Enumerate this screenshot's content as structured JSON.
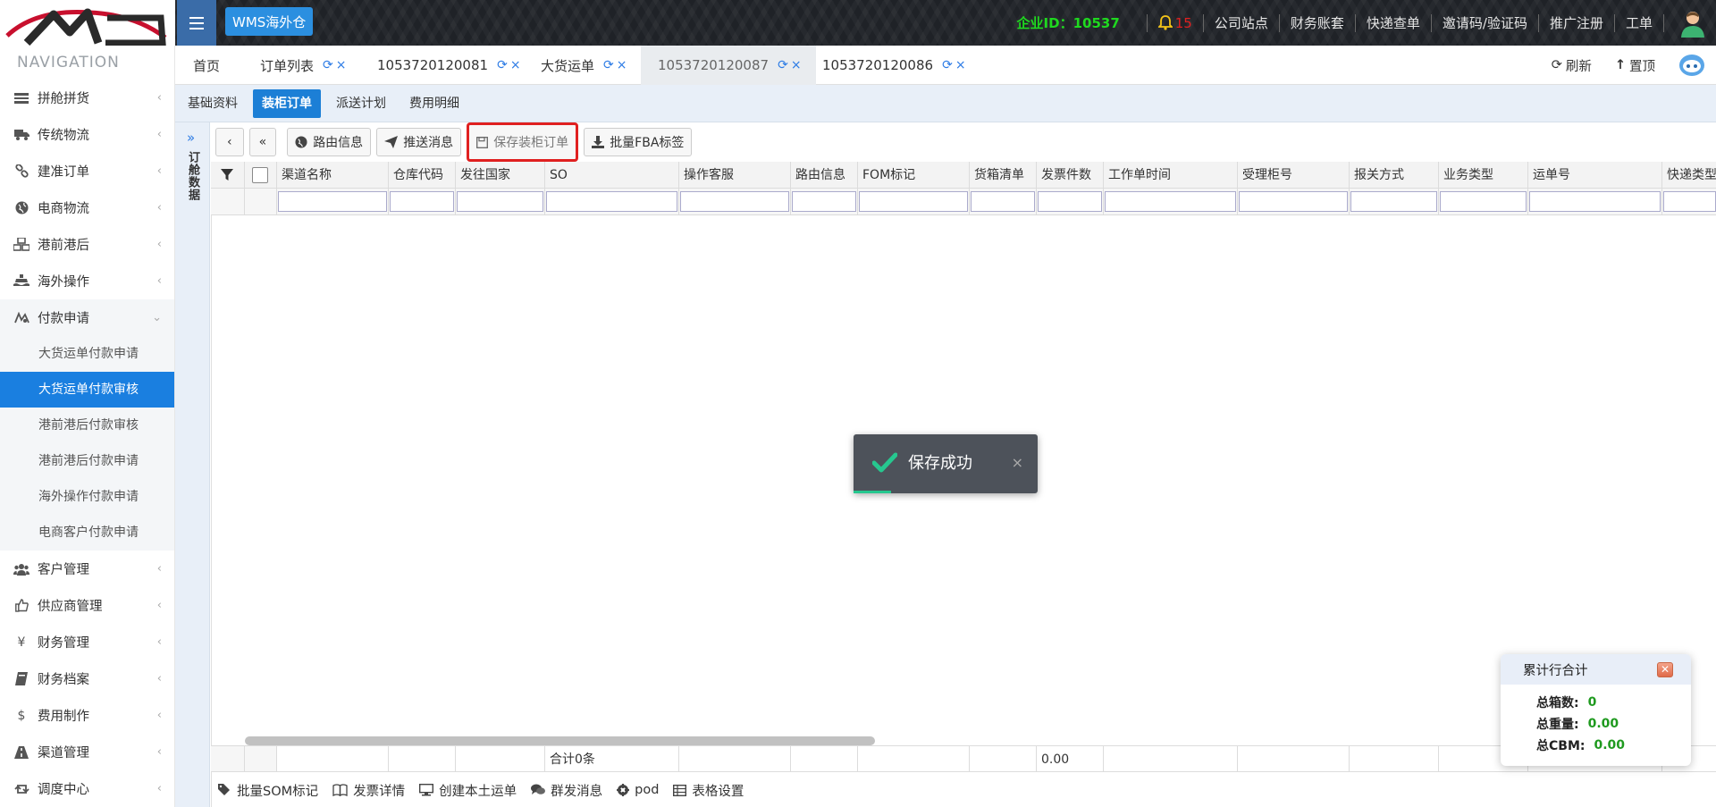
{
  "header": {
    "badge": "WMS海外仓",
    "company_id": "企业ID：10537",
    "notification_count": "15",
    "links": [
      "公司站点",
      "财务账套",
      "快递查单",
      "邀请码/验证码",
      "推广注册",
      "工单"
    ],
    "accent_color": "#1fd91f"
  },
  "sidebar": {
    "title": "NAVIGATION",
    "items": [
      {
        "label": "拼舱拼货",
        "icon": "list-icon"
      },
      {
        "label": "传统物流",
        "icon": "truck-icon"
      },
      {
        "label": "建准订单",
        "icon": "link-icon"
      },
      {
        "label": "电商物流",
        "icon": "globe-icon"
      },
      {
        "label": "港前港后",
        "icon": "cubes-icon"
      },
      {
        "label": "海外操作",
        "icon": "ship-icon"
      },
      {
        "label": "付款申请",
        "icon": "payment-icon"
      }
    ],
    "subitems": [
      "大货运单付款申请",
      "大货运单付款审核",
      "港前港后付款审核",
      "港前港后付款申请",
      "海外操作付款申请",
      "电商客户付款申请"
    ],
    "items_after": [
      {
        "label": "客户管理",
        "icon": "users-icon"
      },
      {
        "label": "供应商管理",
        "icon": "thumbs-up-icon"
      },
      {
        "label": "财务管理",
        "icon": "yen-icon"
      },
      {
        "label": "财务档案",
        "icon": "book-icon"
      },
      {
        "label": "费用制作",
        "icon": "dollar-icon"
      },
      {
        "label": "渠道管理",
        "icon": "road-icon"
      },
      {
        "label": "调度中心",
        "icon": "retweet-icon"
      }
    ]
  },
  "tabs": {
    "items": [
      {
        "label": "首页"
      },
      {
        "label": "订单列表"
      },
      {
        "label": "1053720120081"
      },
      {
        "label": "大货运单"
      },
      {
        "label": "1053720120087"
      },
      {
        "label": "1053720120086"
      }
    ],
    "refresh": "刷新",
    "top": "置顶"
  },
  "subtabs": [
    "基础资料",
    "装柜订单",
    "派送计划",
    "费用明细"
  ],
  "rail_label": "订舱数据",
  "toolbar": {
    "prev": "‹",
    "first": "«",
    "route_info": "路由信息",
    "push_message": "推送消息",
    "save_order": "保存装柜订单",
    "batch_fba": "批量FBA标签"
  },
  "grid": {
    "columns": [
      "渠道名称",
      "仓库代码",
      "发往国家",
      "SO",
      "操作客服",
      "路由信息",
      "FOM标记",
      "货箱清单",
      "发票件数",
      "工作单时间",
      "受理柜号",
      "报关方式",
      "业务类型",
      "运单号",
      "快递类型"
    ],
    "footer_total": "合计0条",
    "footer_invoice": "0.00"
  },
  "bottom": {
    "batch_som": "批量SOM标记",
    "invoice_detail": "发票详情",
    "create_local": "创建本土运单",
    "group_message": "群发消息",
    "pod": "pod",
    "table_settings": "表格设置"
  },
  "toast": {
    "text": "保存成功"
  },
  "summary": {
    "title": "累计行合计",
    "rows": [
      {
        "label": "总箱数:",
        "value": "0"
      },
      {
        "label": "总重量:",
        "value": "0.00"
      },
      {
        "label": "总CBM:",
        "value": "0.00"
      }
    ]
  }
}
